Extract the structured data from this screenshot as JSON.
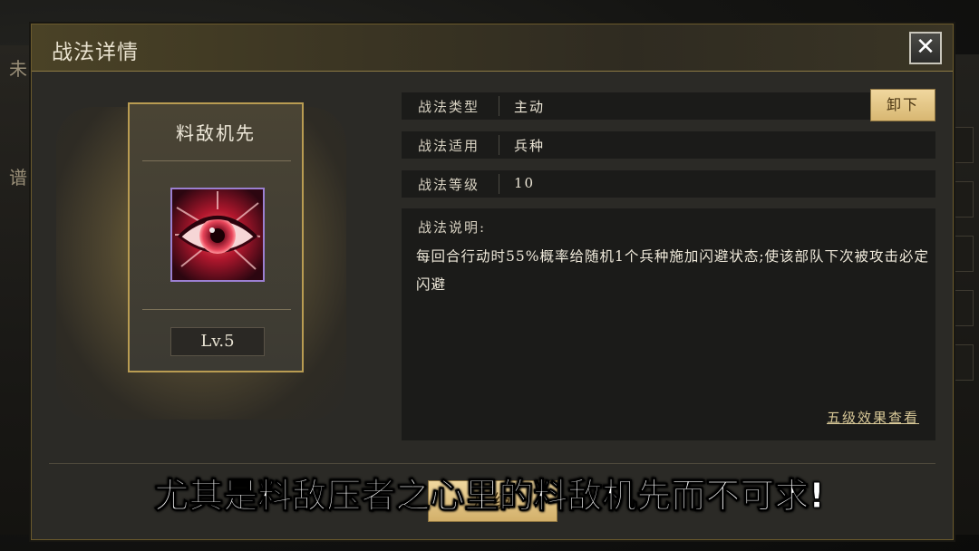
{
  "background": {
    "left_fragments": [
      "未",
      "谱"
    ]
  },
  "dialog": {
    "title": "战法详情",
    "close_icon": "close-icon",
    "accent_color": "#b99c52"
  },
  "skill_card": {
    "name": "料敌机先",
    "icon": "eye-icon",
    "level": "Lv.5"
  },
  "info": {
    "rows": [
      {
        "label": "战法类型",
        "value": "主动"
      },
      {
        "label": "战法适用",
        "value": "兵种"
      },
      {
        "label": "战法等级",
        "value": "10"
      }
    ],
    "unequip_label": "卸下"
  },
  "description": {
    "title": "战法说明:",
    "text": "每回合行动时55%概率给随机1个兵种施加闪避状态;使该部队下次被攻击必定闪避",
    "five_level_link": "五级效果查看"
  },
  "upgrade_button": {
    "label": "升级"
  },
  "subtitle": "尤其是料敌压者之心里的料敌机先而不可求!"
}
